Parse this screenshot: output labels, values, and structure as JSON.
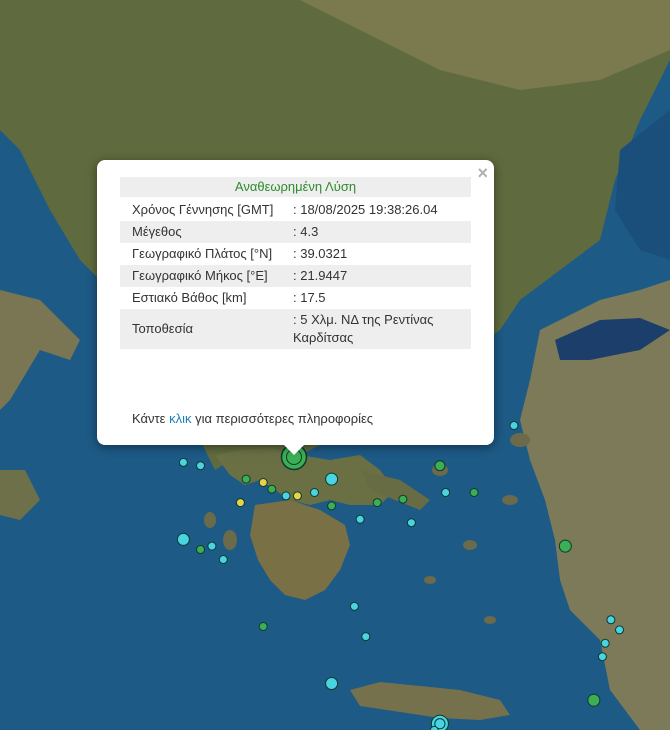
{
  "map": {
    "sea_color": "#1d5a86",
    "land_color": "#6e7048",
    "markers": [
      {
        "lon": 21.94,
        "lat": 39.03,
        "mag": 4.3,
        "color": "#3cae55",
        "highlight": true
      },
      {
        "lon": 22.6,
        "lat": 38.7,
        "mag": 3.0,
        "color": "#49d3e3"
      },
      {
        "lon": 20.3,
        "lat": 38.9,
        "mag": 2.4,
        "color": "#49d3e3"
      },
      {
        "lon": 20.9,
        "lat": 39.3,
        "mag": 2.5,
        "color": "#3cae55"
      },
      {
        "lon": 21.1,
        "lat": 38.7,
        "mag": 2.5,
        "color": "#3cae55"
      },
      {
        "lon": 21.4,
        "lat": 38.65,
        "mag": 2.3,
        "color": "#e8d24a"
      },
      {
        "lon": 21.55,
        "lat": 38.55,
        "mag": 2.3,
        "color": "#3cae55"
      },
      {
        "lon": 21.8,
        "lat": 38.45,
        "mag": 2.4,
        "color": "#49d3e3"
      },
      {
        "lon": 22.0,
        "lat": 38.45,
        "mag": 2.4,
        "color": "#e8d24a"
      },
      {
        "lon": 22.3,
        "lat": 38.5,
        "mag": 2.3,
        "color": "#49d3e3"
      },
      {
        "lon": 22.6,
        "lat": 38.3,
        "mag": 2.3,
        "color": "#3cae55"
      },
      {
        "lon": 23.1,
        "lat": 38.1,
        "mag": 2.3,
        "color": "#49d3e3"
      },
      {
        "lon": 23.4,
        "lat": 38.35,
        "mag": 2.3,
        "color": "#3cae55"
      },
      {
        "lon": 24.5,
        "lat": 38.9,
        "mag": 2.8,
        "color": "#3cae55"
      },
      {
        "lon": 24.6,
        "lat": 38.5,
        "mag": 2.3,
        "color": "#49d3e3"
      },
      {
        "lon": 25.1,
        "lat": 38.5,
        "mag": 2.3,
        "color": "#3cae55"
      },
      {
        "lon": 20.0,
        "lat": 37.8,
        "mag": 3.0,
        "color": "#49d3e3"
      },
      {
        "lon": 20.3,
        "lat": 37.65,
        "mag": 2.4,
        "color": "#3cae55"
      },
      {
        "lon": 20.5,
        "lat": 37.7,
        "mag": 2.4,
        "color": "#49d3e3"
      },
      {
        "lon": 20.7,
        "lat": 37.5,
        "mag": 2.3,
        "color": "#49d3e3"
      },
      {
        "lon": 21.4,
        "lat": 36.5,
        "mag": 2.3,
        "color": "#3cae55"
      },
      {
        "lon": 23.0,
        "lat": 36.8,
        "mag": 2.4,
        "color": "#49d3e3"
      },
      {
        "lon": 23.2,
        "lat": 36.35,
        "mag": 2.3,
        "color": "#49d3e3"
      },
      {
        "lon": 22.6,
        "lat": 35.65,
        "mag": 3.0,
        "color": "#49d3e3"
      },
      {
        "lon": 26.7,
        "lat": 37.7,
        "mag": 3.0,
        "color": "#3cae55"
      },
      {
        "lon": 27.5,
        "lat": 36.6,
        "mag": 2.3,
        "color": "#49d3e3"
      },
      {
        "lon": 27.65,
        "lat": 36.45,
        "mag": 2.3,
        "color": "#49d3e3"
      },
      {
        "lon": 27.4,
        "lat": 36.25,
        "mag": 2.3,
        "color": "#49d3e3"
      },
      {
        "lon": 27.35,
        "lat": 36.05,
        "mag": 2.3,
        "color": "#49d3e3"
      },
      {
        "lon": 27.2,
        "lat": 35.4,
        "mag": 3.0,
        "color": "#3cae55"
      },
      {
        "lon": 24.5,
        "lat": 35.05,
        "mag": 3.5,
        "color": "#49d3e3"
      },
      {
        "lon": 24.4,
        "lat": 34.95,
        "mag": 2.5,
        "color": "#49d3e3"
      },
      {
        "lon": 24.0,
        "lat": 38.05,
        "mag": 2.3,
        "color": "#49d3e3"
      },
      {
        "lon": 23.85,
        "lat": 38.4,
        "mag": 2.6,
        "color": "#3cae55"
      },
      {
        "lon": 20.0,
        "lat": 38.95,
        "mag": 2.3,
        "color": "#49d3e3"
      },
      {
        "lon": 21.0,
        "lat": 38.35,
        "mag": 2.3,
        "color": "#e8d24a"
      },
      {
        "lon": 25.8,
        "lat": 39.5,
        "mag": 2.3,
        "color": "#49d3e3"
      }
    ]
  },
  "popup": {
    "title": "Αναθεωρημένη Λύση",
    "close_symbol": "×",
    "rows": [
      {
        "label": "Χρόνος Γέννησης [GMT]",
        "value": ": 18/08/2025 19:38:26.04"
      },
      {
        "label": "Μέγεθος",
        "value": ": 4.3"
      },
      {
        "label": "Γεωγραφικό Πλάτος [°N]",
        "value": ": 39.0321"
      },
      {
        "label": "Γεωγραφικό Μήκος [°E]",
        "value": ": 21.9447"
      },
      {
        "label": "Εστιακό Βάθος [km]",
        "value": ": 17.5"
      },
      {
        "label": "Τοποθεσία",
        "value": ": 5 Χλμ. ΝΔ της Ρεντίνας Καρδίτσας"
      }
    ],
    "more_before": "Κάντε ",
    "more_link": "κλικ",
    "more_after": " για περισσότερες πληροφορίες"
  }
}
